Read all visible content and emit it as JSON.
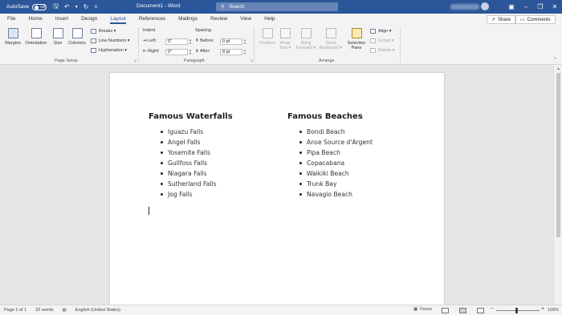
{
  "titlebar": {
    "autosave_label": "AutoSave",
    "autosave_state": "Off",
    "document_title": "Document1 - Word",
    "search_placeholder": "Search"
  },
  "menu": {
    "tabs": [
      "File",
      "Home",
      "Insert",
      "Design",
      "Layout",
      "References",
      "Mailings",
      "Review",
      "View",
      "Help"
    ],
    "active_tab": "Layout",
    "share_label": "Share",
    "comments_label": "Comments"
  },
  "ribbon": {
    "page_setup": {
      "margins": "Margins",
      "orientation": "Orientation",
      "size": "Size",
      "columns": "Columns",
      "breaks": "Breaks ▾",
      "line_numbers": "Line Numbers ▾",
      "hyphenation": "Hyphenation ▾",
      "group_label": "Page Setup"
    },
    "paragraph": {
      "indent_label": "Indent",
      "spacing_label": "Spacing",
      "left_label": "Left:",
      "left_value": "0\"",
      "right_label": "Right:",
      "right_value": "0\"",
      "before_label": "Before:",
      "before_value": "0 pt",
      "after_label": "After:",
      "after_value": "8 pt",
      "group_label": "Paragraph"
    },
    "arrange": {
      "position": "Position",
      "wrap_text": "Wrap Text ▾",
      "bring_forward": "Bring Forward ▾",
      "send_backward": "Send Backward ▾",
      "selection_pane": "Selection Pane",
      "align": "Align ▾",
      "group": "Group ▾",
      "rotate": "Rotate ▾",
      "group_label": "Arrange"
    }
  },
  "document": {
    "left_column": {
      "heading": "Famous Waterfalls",
      "items": [
        "Iguazu Falls",
        "Angel Falls",
        "Yosemite Falls",
        "Gullfoss Falls",
        "Niagara Falls",
        "Sutherland Falls",
        "Jog Falls"
      ]
    },
    "right_column": {
      "heading": "Famous Beaches",
      "items": [
        "Bondi Beach",
        "Anse Source d'Argent",
        "Pipa Beach",
        "Copacabana",
        "Waikiki Beach",
        "Trunk Bay",
        "Navagio Beach"
      ]
    }
  },
  "statusbar": {
    "page": "Page 1 of 1",
    "words": "32 words",
    "language": "English (United States)",
    "focus": "Focus",
    "zoom": "100%"
  }
}
